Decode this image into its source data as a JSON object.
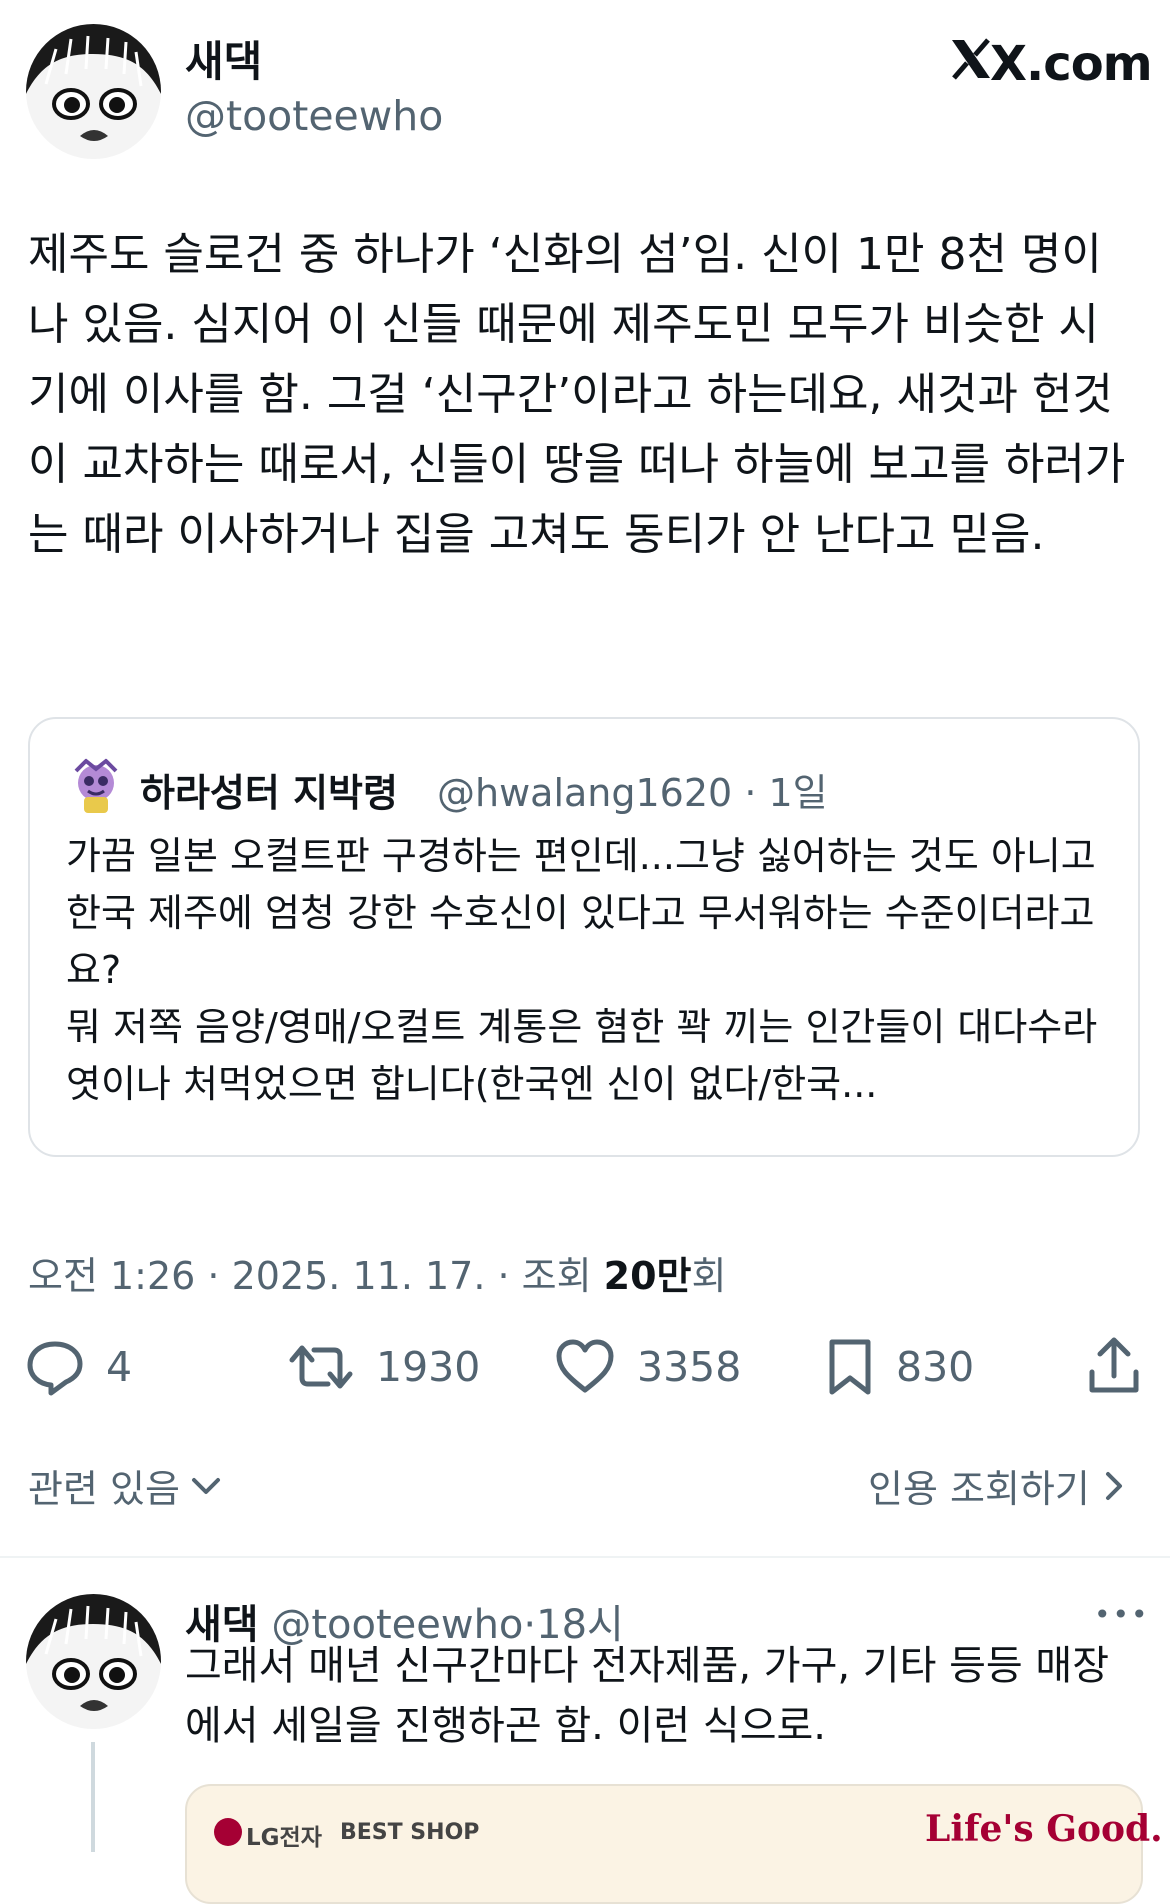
{
  "header": {
    "display_name": "새댁",
    "handle": "@tooteewho",
    "brand": "X.com"
  },
  "tweet": {
    "text": "제주도 슬로건 중 하나가 ‘신화의 섬’임. 신이 1만 8천 명이나 있음. 심지어 이 신들 때문에 제주도민 모두가 비슷한 시기에 이사를 함. 그걸 ‘신구간’이라고 하는데요, 새것과 헌것이 교차하는 때로서, 신들이 땅을 떠나 하늘에 보고를 하러가는 때라 이사하거나 집을 고쳐도 동티가 안 난다고 믿음."
  },
  "quote": {
    "name": "하라성터 지박령",
    "handle": "@hwalang1620",
    "sep": "·",
    "time": "1일",
    "text": "가끔 일본 오컬트판 구경하는 편인데...그냥 싫어하는 것도 아니고 한국 제주에 엄청 강한 수호신이 있다고 무서워하는 수준이더라고요?\n뭐 저쪽 음양/영매/오컬트 계통은 혐한 꽉 끼는 인간들이 대다수라 엿이나 처먹었으면 합니다(한국엔 신이 없다/한국..."
  },
  "meta": {
    "time": "오전 1:26",
    "sep1": " · ",
    "date": "2025. 11. 17.",
    "sep2": " · ",
    "views_label": "조회 ",
    "views_count": "20만",
    "views_unit": "회"
  },
  "actions": {
    "replies": "4",
    "reposts": "1930",
    "likes": "3358",
    "bookmarks": "830"
  },
  "links": {
    "related": "관련 있음",
    "quote_views": "인용 조회하기"
  },
  "reply": {
    "display_name": "새댁",
    "handle": "@tooteewho",
    "sep": "·",
    "time": "18시",
    "more": "•••",
    "text": "그래서 매년 신구간마다 전자제품, 가구, 기타 등등 매장에서 세일을 진행하곤 함. 이런 식으로.",
    "media": {
      "brand_left": "LG전자",
      "brand_mid": "BEST SHOP",
      "brand_right": "Life's Good."
    }
  },
  "colors": {
    "text": "#0f1419",
    "secondary": "#536471",
    "border": "#dfe3e7",
    "lg_red": "#a50034"
  },
  "icons": [
    "x-logo-icon",
    "reply-icon",
    "repost-icon",
    "like-icon",
    "bookmark-icon",
    "share-icon",
    "chevron-down-icon",
    "chevron-right-icon",
    "more-icon"
  ]
}
